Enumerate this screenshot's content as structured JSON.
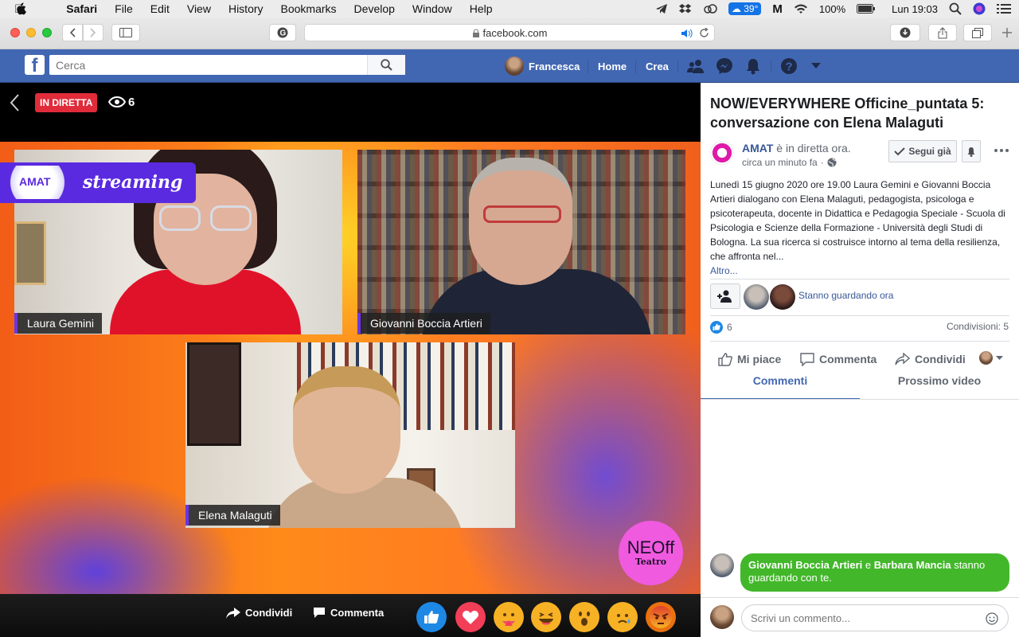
{
  "menubar": {
    "app": "Safari",
    "items": [
      "File",
      "Edit",
      "View",
      "History",
      "Bookmarks",
      "Develop",
      "Window",
      "Help"
    ],
    "temperature": "39°",
    "battery": "100%",
    "clock": "Lun 19:03"
  },
  "browser": {
    "url": "facebook.com"
  },
  "fb_header": {
    "search_placeholder": "Cerca",
    "user_name": "Francesca",
    "home_label": "Home",
    "create_label": "Crea"
  },
  "video": {
    "live_label": "IN DIRETTA",
    "viewer_count": "6",
    "banner_brand": "AMAT",
    "banner_text": "streaming",
    "participants": [
      "Laura Gemini",
      "Giovanni Boccia Artieri",
      "Elena Malaguti"
    ],
    "logo_line1": "NEOff",
    "logo_line2": "Teatro",
    "share_label": "Condividi",
    "comment_label": "Commenta",
    "reactions": [
      "like",
      "love",
      "care",
      "haha",
      "wow",
      "sad",
      "angry"
    ]
  },
  "panel": {
    "title": "NOW/EVERYWHERE Officine_puntata 5: conversazione con Elena Malaguti",
    "page_name": "AMAT",
    "live_status": "è in diretta ora.",
    "time": "circa un minuto fa",
    "follow_label": "Segui già",
    "description": "Lunedì 15 giugno 2020 ore 19.00 Laura Gemini e Giovanni Boccia Artieri dialogano con Elena Malaguti, pedagogista, psicologa e psicoterapeuta, docente in Didattica e Pedagogia Speciale - Scuola di Psicologia e Scienze della Formazione - Università degli Studi di Bologna. La sua ricerca si costruisce intorno al tema della resilienza, che affronta nel...",
    "more_label": "Altro...",
    "watching_label": "Stanno guardando ora",
    "like_count": "6",
    "shares": "Condivisioni: 5",
    "actions": {
      "like": "Mi piace",
      "comment": "Commenta",
      "share": "Condividi"
    },
    "tabs": [
      "Commenti",
      "Prossimo video"
    ],
    "notice_name1": "Giovanni Boccia Artieri",
    "notice_and": " e ",
    "notice_name2": "Barbara Mancia",
    "notice_rest": " stanno guardando con te.",
    "comment_placeholder": "Scrivi un commento..."
  },
  "colors": {
    "fb_blue": "#4267b2",
    "live_red": "#e02c3a",
    "notice_green": "#42b72a",
    "accent_purple": "#6a35e6"
  }
}
